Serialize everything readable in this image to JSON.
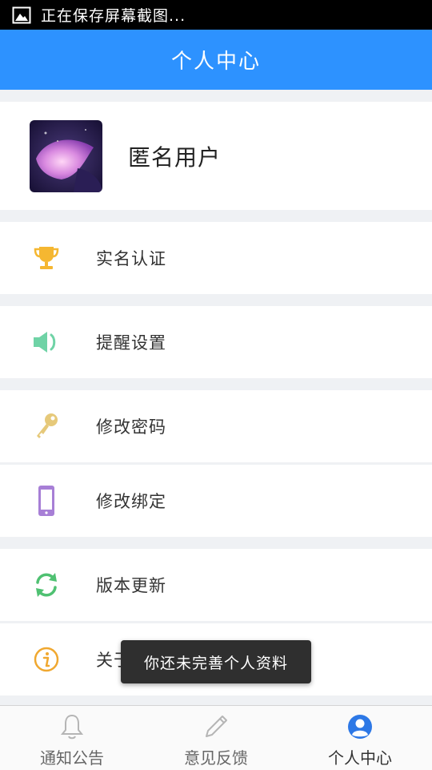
{
  "status_bar": {
    "text": "正在保存屏幕截图..."
  },
  "header": {
    "title": "个人中心"
  },
  "profile": {
    "username": "匿名用户"
  },
  "menu": [
    {
      "label": "实名认证",
      "icon": "trophy-icon",
      "color": "#f5b731"
    },
    {
      "label": "提醒设置",
      "icon": "speaker-icon",
      "color": "#6fd3a6"
    },
    {
      "label": "修改密码",
      "icon": "key-icon",
      "color": "#e6c97a"
    },
    {
      "label": "修改绑定",
      "icon": "phone-icon",
      "color": "#a77fd6"
    },
    {
      "label": "版本更新",
      "icon": "refresh-icon",
      "color": "#4fc172"
    },
    {
      "label": "关于",
      "icon": "info-icon",
      "color": "#f0a830"
    }
  ],
  "toast": {
    "text": "你还未完善个人资料"
  },
  "tabs": [
    {
      "label": "通知公告",
      "icon": "bell-icon"
    },
    {
      "label": "意见反馈",
      "icon": "pencil-icon"
    },
    {
      "label": "个人中心",
      "icon": "user-icon",
      "active": true
    }
  ],
  "colors": {
    "brand": "#2d92ff",
    "active_tab": "#2d92ff"
  }
}
